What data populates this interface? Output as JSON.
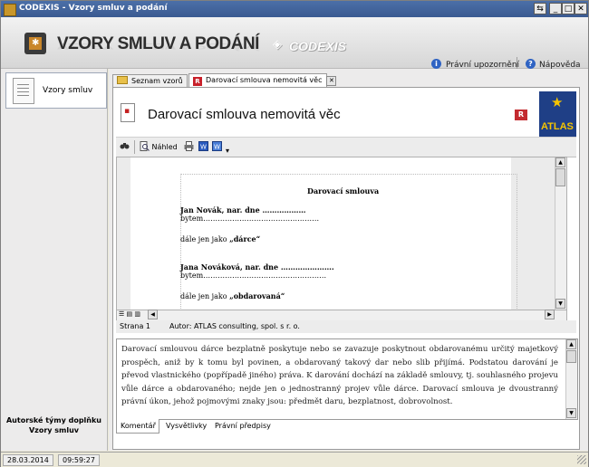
{
  "window": {
    "title": "CODEXIS - Vzory smluv a podání"
  },
  "header": {
    "app_title": "VZORY SMLUV A PODÁNÍ",
    "brand": "CODEXIS",
    "links": {
      "legal": "Právní upozornění",
      "help": "Nápověda"
    }
  },
  "sidebar": {
    "items": [
      {
        "label": "Vzory smluv"
      }
    ],
    "footer_line1": "Autorské týmy doplňku",
    "footer_line2": "Vzory smluv"
  },
  "tabs": [
    {
      "label": "Seznam vzorů",
      "icon": "folder-icon"
    },
    {
      "label": "Darovací smlouva nemovitá věc",
      "icon": "r-icon",
      "close": "✕"
    }
  ],
  "document": {
    "title": "Darovací smlouva nemovitá věc",
    "badge": "R",
    "logo": "ATLAS"
  },
  "toolbar": {
    "preview_label": "Náhled"
  },
  "preview": {
    "heading": "Darovací smlouva",
    "line1": "Jan Novák, nar. dne ………………",
    "line2": "bytem…………………………………………",
    "line3_prefix": "dále jen jako ",
    "line3_bold": "„dárce“",
    "line4": "Jana Nováková, nar. dne ………………….",
    "line5": "bytem……………………………………………",
    "line6_prefix": "dále jen jako ",
    "line6_bold": "„obdarovaná“"
  },
  "status": {
    "page": "Strana 1",
    "author": "Autor: ATLAS consulting, spol. s r. o."
  },
  "comment": {
    "text": "Darovací smlouvou dárce bezplatně poskytuje nebo se zavazuje poskytnout obdarovanému určitý majetkový prospěch, aniž by k tomu byl povinen, a obdarovaný takový dar nebo slib přijímá. Podstatou darování je převod vlastnického (popřípadě jiného) práva. K darování dochází na základě smlouvy, tj. souhlasného projevu vůle dárce a obdarovaného; nejde jen o jednostranný projev vůle dárce. Darovací smlouva je dvoustranný právní úkon, jehož pojmovými znaky jsou: předmět daru, bezplatnost, dobrovolnost."
  },
  "bottom_tabs": [
    "Komentář",
    "Vysvětlivky",
    "Právní předpisy"
  ],
  "statusbar": {
    "date": "28.03.2014",
    "time": "09:59:27"
  }
}
